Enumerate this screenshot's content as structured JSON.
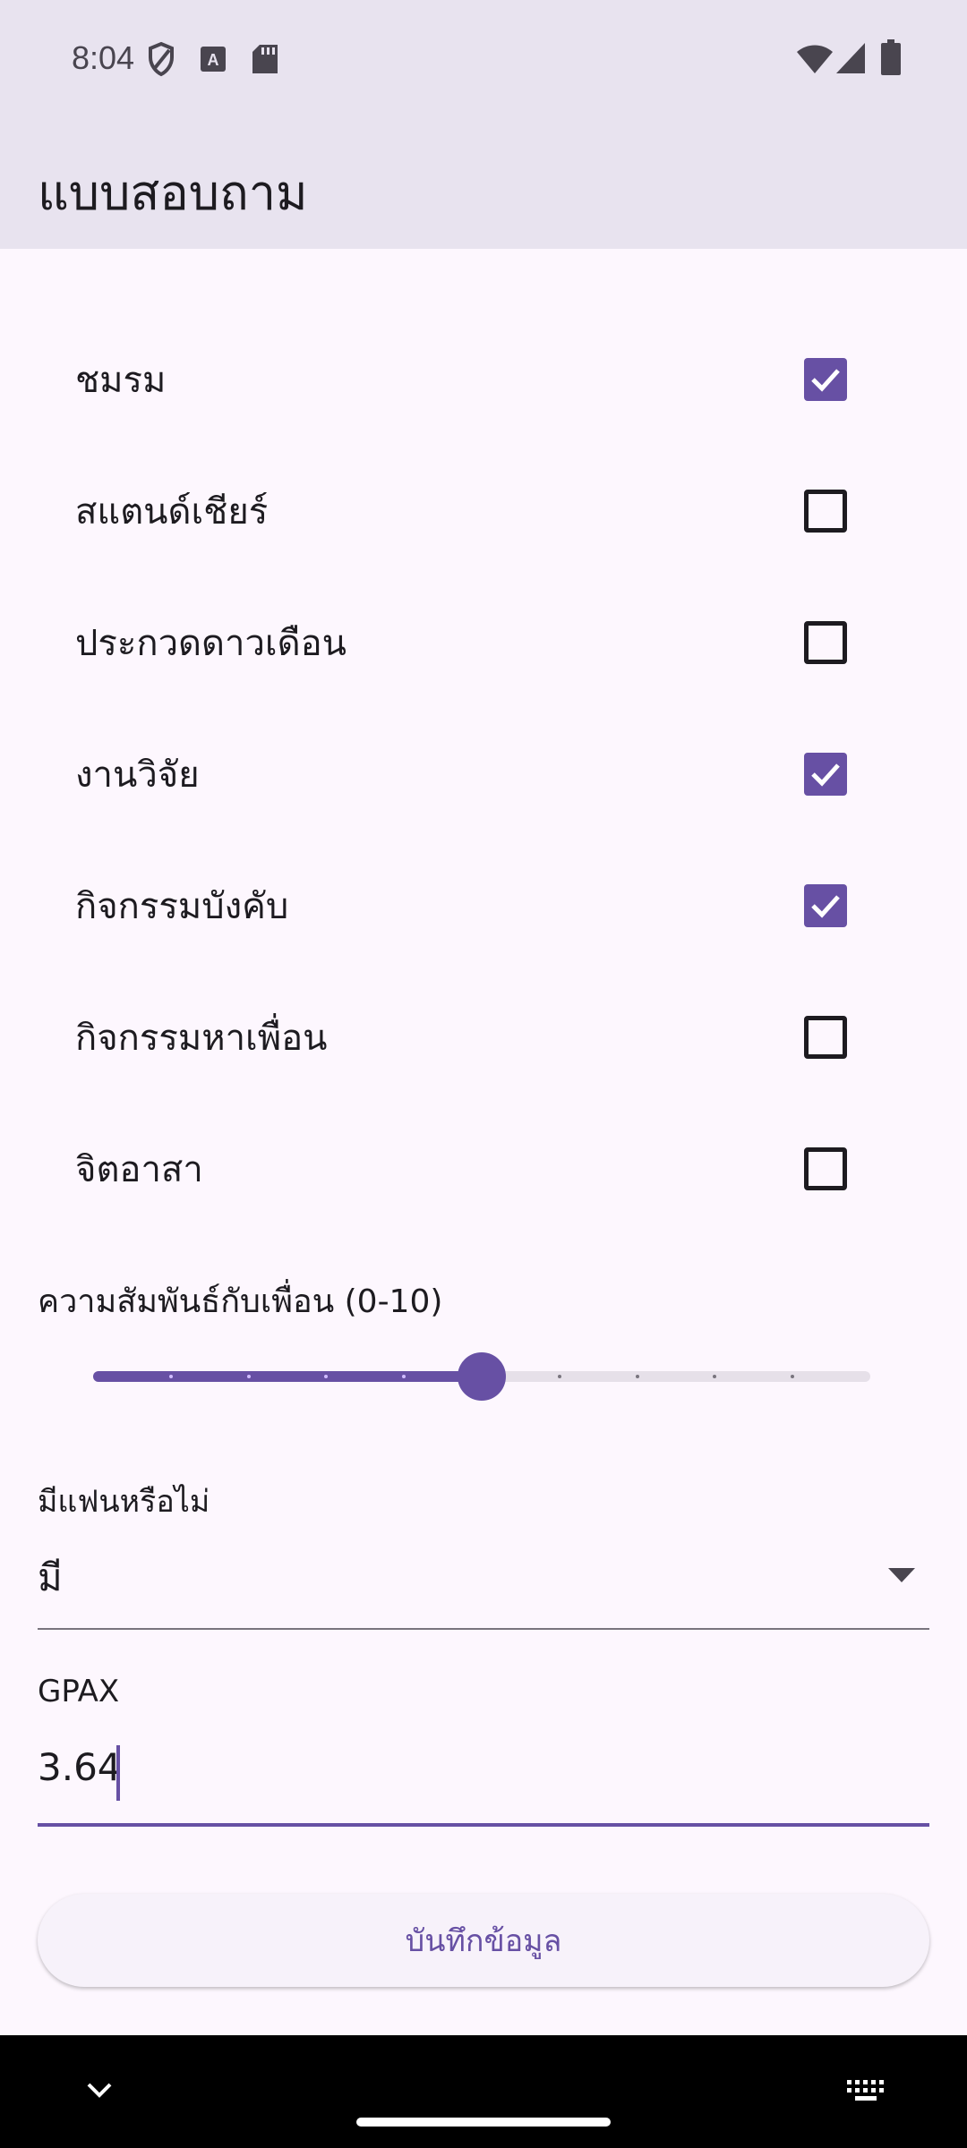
{
  "status_bar": {
    "time": "8:04",
    "left_icons": [
      "shield-icon",
      "a-font-icon",
      "sd-card-icon"
    ],
    "right_icons": [
      "wifi-icon",
      "signal-icon",
      "battery-icon"
    ]
  },
  "app_bar": {
    "title": "แบบสอบถาม"
  },
  "options": [
    {
      "label": "ชมรม",
      "checked": true
    },
    {
      "label": "สแตนด์เชียร์",
      "checked": false
    },
    {
      "label": "ประกวดดาวเดือน",
      "checked": false
    },
    {
      "label": "งานวิจัย",
      "checked": true
    },
    {
      "label": "กิจกรรมบังคับ",
      "checked": true
    },
    {
      "label": "กิจกรรมหาเพื่อน",
      "checked": false
    },
    {
      "label": "จิตอาสา",
      "checked": false
    }
  ],
  "slider": {
    "label": "ความสัมพันธ์กับเพื่อน (0-10)",
    "min": 0,
    "max": 10,
    "value": 5
  },
  "partner": {
    "label": "มีแฟนหรือไม่",
    "value": "มี"
  },
  "gpax": {
    "label": "GPAX",
    "value": "3.64"
  },
  "save_button": {
    "label": "บันทึกข้อมูล"
  },
  "colors": {
    "accent": "#6750a4",
    "background": "#fdf7fe",
    "app_bar": "#e8e3ef"
  },
  "nav_bar": {
    "icons": [
      "chevron-down-icon",
      "keyboard-icon"
    ]
  }
}
